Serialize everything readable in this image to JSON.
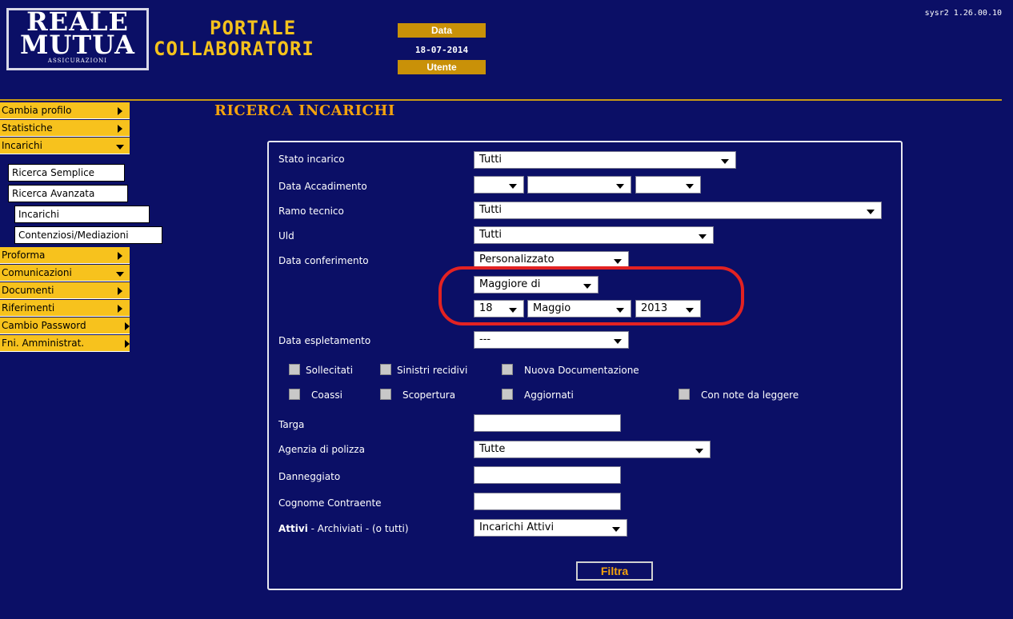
{
  "header": {
    "logo": {
      "line1": "REALE",
      "line2": "MUTUA",
      "line3": "ASSICURAZIONI"
    },
    "title_line1": "PORTALE",
    "title_line2": "COLLABORATORI",
    "date_label": "Data",
    "date_value": "18-07-2014",
    "user_label": "Utente",
    "version": "sysr2 1.26.00.10"
  },
  "sidebar": {
    "items": [
      {
        "label": "Cambia profilo"
      },
      {
        "label": "Statistiche"
      },
      {
        "label": "Incarichi"
      },
      {
        "label": "Proforma"
      },
      {
        "label": "Comunicazioni"
      },
      {
        "label": "Documenti"
      },
      {
        "label": "Riferimenti"
      },
      {
        "label": "Cambio Password"
      },
      {
        "label": "Fni. Amministrat."
      }
    ],
    "incarichi_sub": {
      "ricerca_semplice": "Ricerca Semplice",
      "ricerca_avanzata": "Ricerca Avanzata",
      "incarichi": "Incarichi",
      "contenziosi": "Contenziosi/Mediazioni"
    }
  },
  "page_title": "RICERCA INCARICHI",
  "form": {
    "stato_incarico": {
      "label": "Stato incarico",
      "value": "Tutti"
    },
    "data_accadimento": {
      "label": "Data Accadimento",
      "day": "",
      "month": "",
      "year": ""
    },
    "ramo_tecnico": {
      "label": "Ramo tecnico",
      "value": "Tutti"
    },
    "uld": {
      "label": "Uld",
      "value": "Tutti"
    },
    "data_conferimento": {
      "label": "Data conferimento",
      "value": "Personalizzato",
      "operator": "Maggiore di",
      "day": "18",
      "month": "Maggio",
      "year": "2013"
    },
    "data_espletamento": {
      "label": "Data espletamento",
      "value": "---"
    },
    "checkboxes": {
      "sollecitati": "Sollecitati",
      "sinistri_recidivi": "Sinistri recidivi",
      "nuova_documentazione": "Nuova Documentazione",
      "coassi": "Coassi",
      "scopertura": "Scopertura",
      "aggiornati": "Aggiornati",
      "con_note": "Con note da leggere"
    },
    "targa": {
      "label": "Targa",
      "value": ""
    },
    "agenzia_polizza": {
      "label": "Agenzia di polizza",
      "value": "Tutte"
    },
    "danneggiato": {
      "label": "Danneggiato",
      "value": ""
    },
    "cognome_contraente": {
      "label": "Cognome Contraente",
      "value": ""
    },
    "attivi": {
      "label_bold": "Attivi",
      "label_rest": " - Archiviati - (o tutti)",
      "value": "Incarichi Attivi"
    },
    "submit_label": "Filtra"
  },
  "colors": {
    "background": "#0b0f66",
    "menu": "#f7c21d",
    "accent": "#f4a30d",
    "badge": "#c99108",
    "highlight": "#e32222"
  }
}
